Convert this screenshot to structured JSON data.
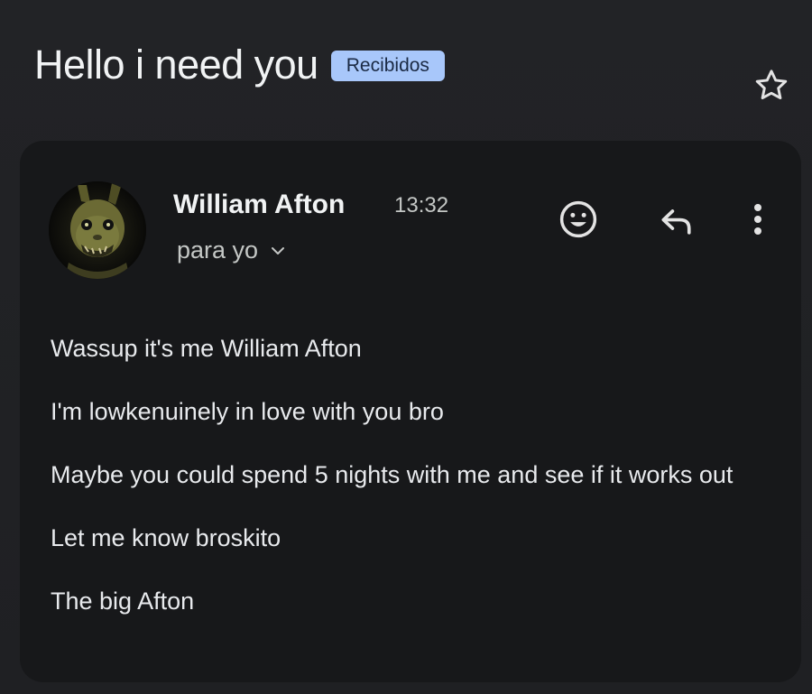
{
  "email": {
    "subject": "Hello i need you",
    "label": "Recibidos",
    "sender": {
      "name": "William Afton",
      "time": "13:32",
      "recipient": "para yo"
    },
    "body_lines": [
      "Wassup it's me William Afton",
      "I'm lowkenuinely in love with you bro",
      "Maybe you could spend 5 nights with me and see if it works out",
      "Let me know broskito",
      "The big Afton"
    ]
  },
  "icons": {
    "star": "star-outline-icon",
    "emoji": "add-reaction-icon",
    "reply": "reply-icon",
    "more": "more-vert-icon",
    "expand": "chevron-down-icon"
  },
  "colors": {
    "background": "#202124",
    "card": "#17181a",
    "label_chip": "#a8c7fa",
    "text": "#e8eaed"
  }
}
